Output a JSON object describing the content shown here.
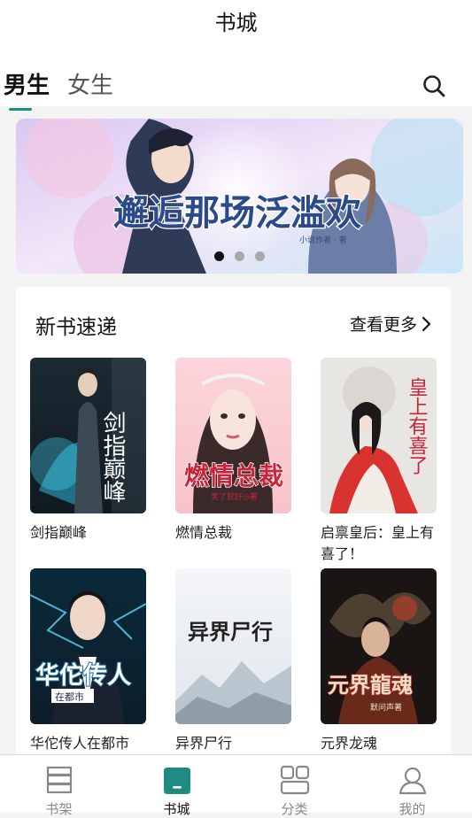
{
  "header": {
    "title": "书城",
    "tabs": [
      {
        "label": "男生",
        "active": true
      },
      {
        "label": "女生",
        "active": false
      }
    ]
  },
  "banner": {
    "text": "邂逅那场泛滥欢",
    "author_line": "小说作者 · 著",
    "slide_count": 3,
    "active_slide": 1
  },
  "section": {
    "title": "新书速递",
    "more_label": "查看更多"
  },
  "books": [
    {
      "title": "剑指巅峰",
      "cover_text": "剑指巅峰",
      "cover_sub": ""
    },
    {
      "title": "燃情总裁",
      "cover_text": "燃情总裁",
      "cover_sub": "笑了就好◎著"
    },
    {
      "title": "启禀皇后：皇上有喜了！",
      "cover_text": "皇上有喜了",
      "cover_sub": ""
    },
    {
      "title": "华佗传人在都市",
      "cover_text": "华佗传人",
      "cover_sub": "在都市"
    },
    {
      "title": "异界尸行",
      "cover_text": "异界尸行",
      "cover_sub": ""
    },
    {
      "title": "元界龙魂",
      "cover_text": "元界龍魂",
      "cover_sub": "默问声著"
    }
  ],
  "bottom_nav": [
    {
      "label": "书架",
      "icon": "bookshelf-icon",
      "active": false
    },
    {
      "label": "书城",
      "icon": "bookstore-icon",
      "active": true
    },
    {
      "label": "分类",
      "icon": "category-icon",
      "active": false
    },
    {
      "label": "我的",
      "icon": "profile-icon",
      "active": false
    }
  ],
  "colors": {
    "accent": "#1f8c84",
    "background": "#f3f3f3"
  }
}
